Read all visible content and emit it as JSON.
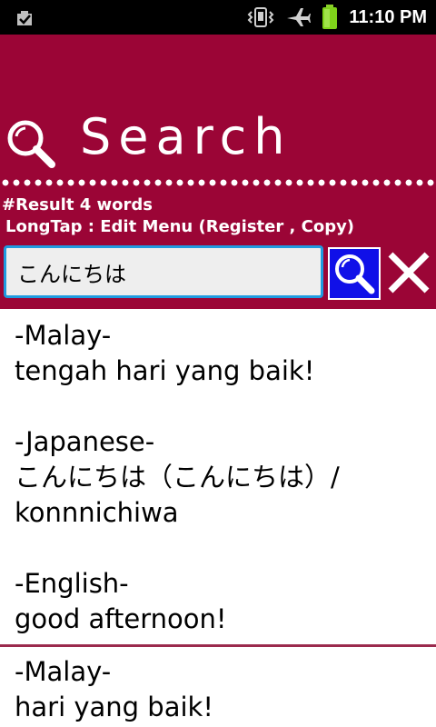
{
  "status_bar": {
    "time": "11:10 PM",
    "icons": [
      "download-done-icon",
      "vibrate-icon",
      "airplane-mode-icon",
      "battery-icon"
    ]
  },
  "header": {
    "title": "Search",
    "result_count": "#Result 4 words",
    "hint": "LongTap : Edit Menu (Register , Copy)"
  },
  "search": {
    "value": "こんにちは",
    "placeholder": ""
  },
  "colors": {
    "header_bg": "#9b0536",
    "input_border": "#1f9be0",
    "search_button_bg": "#1010e8",
    "divider": "#9b2a4d"
  },
  "results": [
    {
      "malay_label": "-Malay-",
      "malay_text": "tengah hari yang baik!",
      "japanese_label": "-Japanese-",
      "japanese_text": "こんにちは（こんにちは）/",
      "japanese_romaji": "konnnichiwa",
      "english_label": "-English-",
      "english_text": "good afternoon!"
    },
    {
      "malay_label": "-Malay-",
      "malay_text": "hari yang baik!"
    }
  ]
}
